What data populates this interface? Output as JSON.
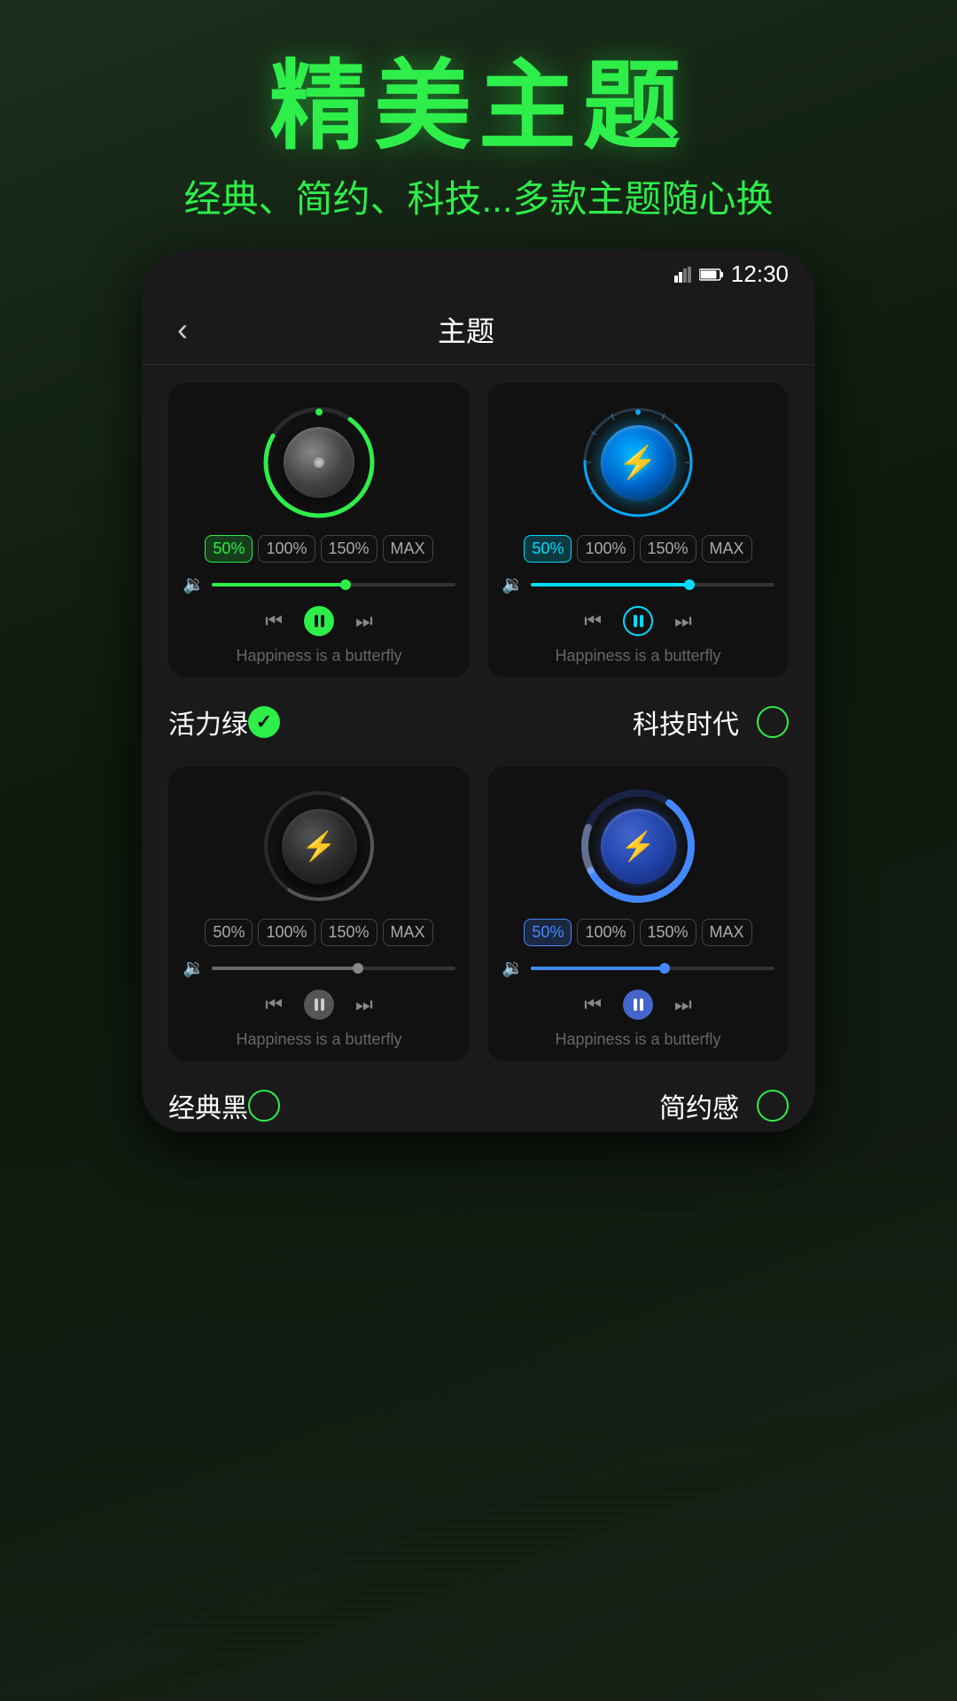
{
  "page": {
    "bg_color": "#1a2a1a"
  },
  "header": {
    "main_title": "精美主题",
    "sub_title": "经典、简约、科技...多款主题随心换"
  },
  "status_bar": {
    "time": "12:30"
  },
  "nav": {
    "back_label": "‹",
    "title": "主题"
  },
  "themes": [
    {
      "id": "vitality_green",
      "name": "活力绿",
      "selected": true,
      "speed_buttons": [
        "50%",
        "100%",
        "150%",
        "MAX"
      ],
      "active_speed": 0,
      "song": "Happiness is a butterfly",
      "style": "green"
    },
    {
      "id": "tech_era",
      "name": "科技时代",
      "selected": false,
      "speed_buttons": [
        "50%",
        "100%",
        "150%",
        "MAX"
      ],
      "active_speed": 0,
      "song": "Happiness is a butterfly",
      "style": "cyan"
    },
    {
      "id": "classic_black",
      "name": "经典黑",
      "selected": false,
      "speed_buttons": [
        "50%",
        "100%",
        "150%",
        "MAX"
      ],
      "active_speed": 0,
      "song": "Happiness is a butterfly",
      "style": "gray"
    },
    {
      "id": "simple_feel",
      "name": "简约感",
      "selected": false,
      "speed_buttons": [
        "50%",
        "100%",
        "150%",
        "MAX"
      ],
      "active_speed": 0,
      "song": "Happiness is a butterfly",
      "style": "blue"
    }
  ]
}
